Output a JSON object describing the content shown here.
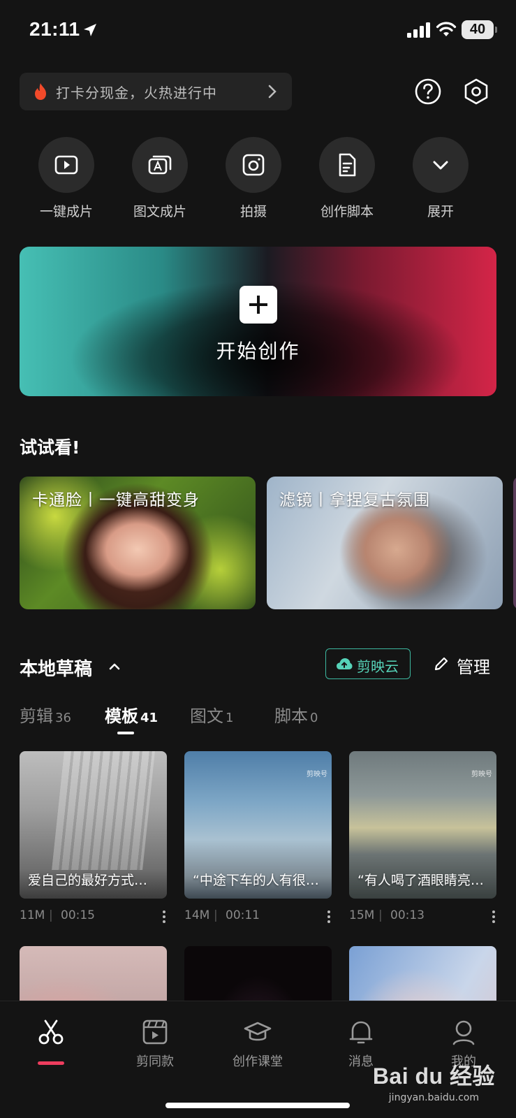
{
  "status_bar": {
    "time": "21:11",
    "battery": "40"
  },
  "promo": {
    "text": "打卡分现金，火热进行中"
  },
  "quick_actions": [
    {
      "label": "一键成片",
      "icon": "play-square-icon"
    },
    {
      "label": "图文成片",
      "icon": "text-image-icon"
    },
    {
      "label": "拍摄",
      "icon": "camera-icon"
    },
    {
      "label": "创作脚本",
      "icon": "script-doc-icon"
    },
    {
      "label": "展开",
      "icon": "chevron-down-icon"
    }
  ],
  "create": {
    "label": "开始创作"
  },
  "try_section": {
    "title": "试试看!",
    "cards": [
      {
        "title": "卡通脸丨一键高甜变身"
      },
      {
        "title": "滤镜丨拿捏复古氛围"
      }
    ]
  },
  "drafts": {
    "title": "本地草稿",
    "cloud_label": "剪映云",
    "manage_label": "管理",
    "tabs": [
      {
        "label": "剪辑",
        "count": "36",
        "active": false
      },
      {
        "label": "模板",
        "count": "41",
        "active": true
      },
      {
        "label": "图文",
        "count": "1",
        "active": false
      },
      {
        "label": "脚本",
        "count": "0",
        "active": false
      }
    ],
    "items": [
      {
        "caption": "爱自己的最好方式…",
        "size": "11M",
        "duration": "00:15",
        "watermark": ""
      },
      {
        "caption": "“中途下车的人有很…",
        "size": "14M",
        "duration": "00:11",
        "watermark": "剪映号"
      },
      {
        "caption": "“有人喝了酒眼睛亮…",
        "size": "15M",
        "duration": "00:13",
        "watermark": "剪映号"
      }
    ]
  },
  "nav": [
    {
      "label": "",
      "icon": "scissors-icon",
      "active": true
    },
    {
      "label": "剪同款",
      "icon": "clapper-icon"
    },
    {
      "label": "创作课堂",
      "icon": "graduation-cap-icon"
    },
    {
      "label": "消息",
      "icon": "bell-icon"
    },
    {
      "label": "我的",
      "icon": "profile-icon"
    }
  ],
  "watermark": {
    "logo": "Bai du 经验",
    "url": "jingyan.baidu.com"
  },
  "colors": {
    "accent_red": "#ee3d5e",
    "cloud_teal": "#3db8a0",
    "background": "#141414"
  }
}
